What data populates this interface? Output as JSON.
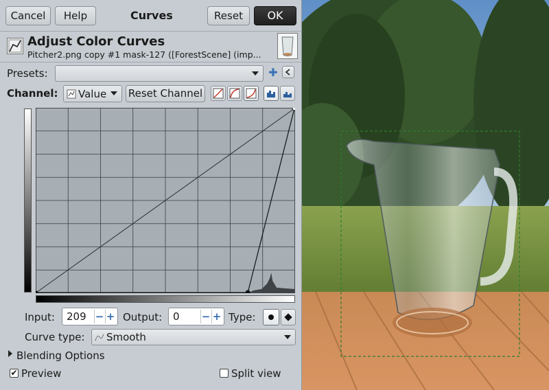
{
  "buttons": {
    "cancel": "Cancel",
    "help": "Help",
    "reset": "Reset",
    "ok": "OK",
    "reset_channel": "Reset Channel"
  },
  "dialog_title": "Curves",
  "header": {
    "title": "Adjust Color Curves",
    "subtitle": "Pitcher2.png copy #1 mask-127 ([ForestScene] (imp..."
  },
  "presets": {
    "label": "Presets:",
    "value": ""
  },
  "channel": {
    "label": "Channel:",
    "value": "Value"
  },
  "inputs": {
    "input_label": "Input:",
    "input_value": "209",
    "output_label": "Output:",
    "output_value": "0",
    "type_label": "Type:"
  },
  "curve_type": {
    "label": "Curve type:",
    "value": "Smooth"
  },
  "blending": {
    "label": "Blending Options"
  },
  "preview": {
    "label": "Preview",
    "checked": true
  },
  "split_view": {
    "label": "Split view",
    "checked": false
  },
  "curve": {
    "points": [
      [
        0,
        0
      ],
      [
        209,
        0
      ],
      [
        255,
        255
      ]
    ],
    "linear_reference": [
      [
        0,
        0
      ],
      [
        255,
        255
      ]
    ]
  },
  "colors": {
    "dialog_bg": "#c6ccd1",
    "graph_bg": "#a7afb5",
    "selection": "#2f7d2f"
  }
}
